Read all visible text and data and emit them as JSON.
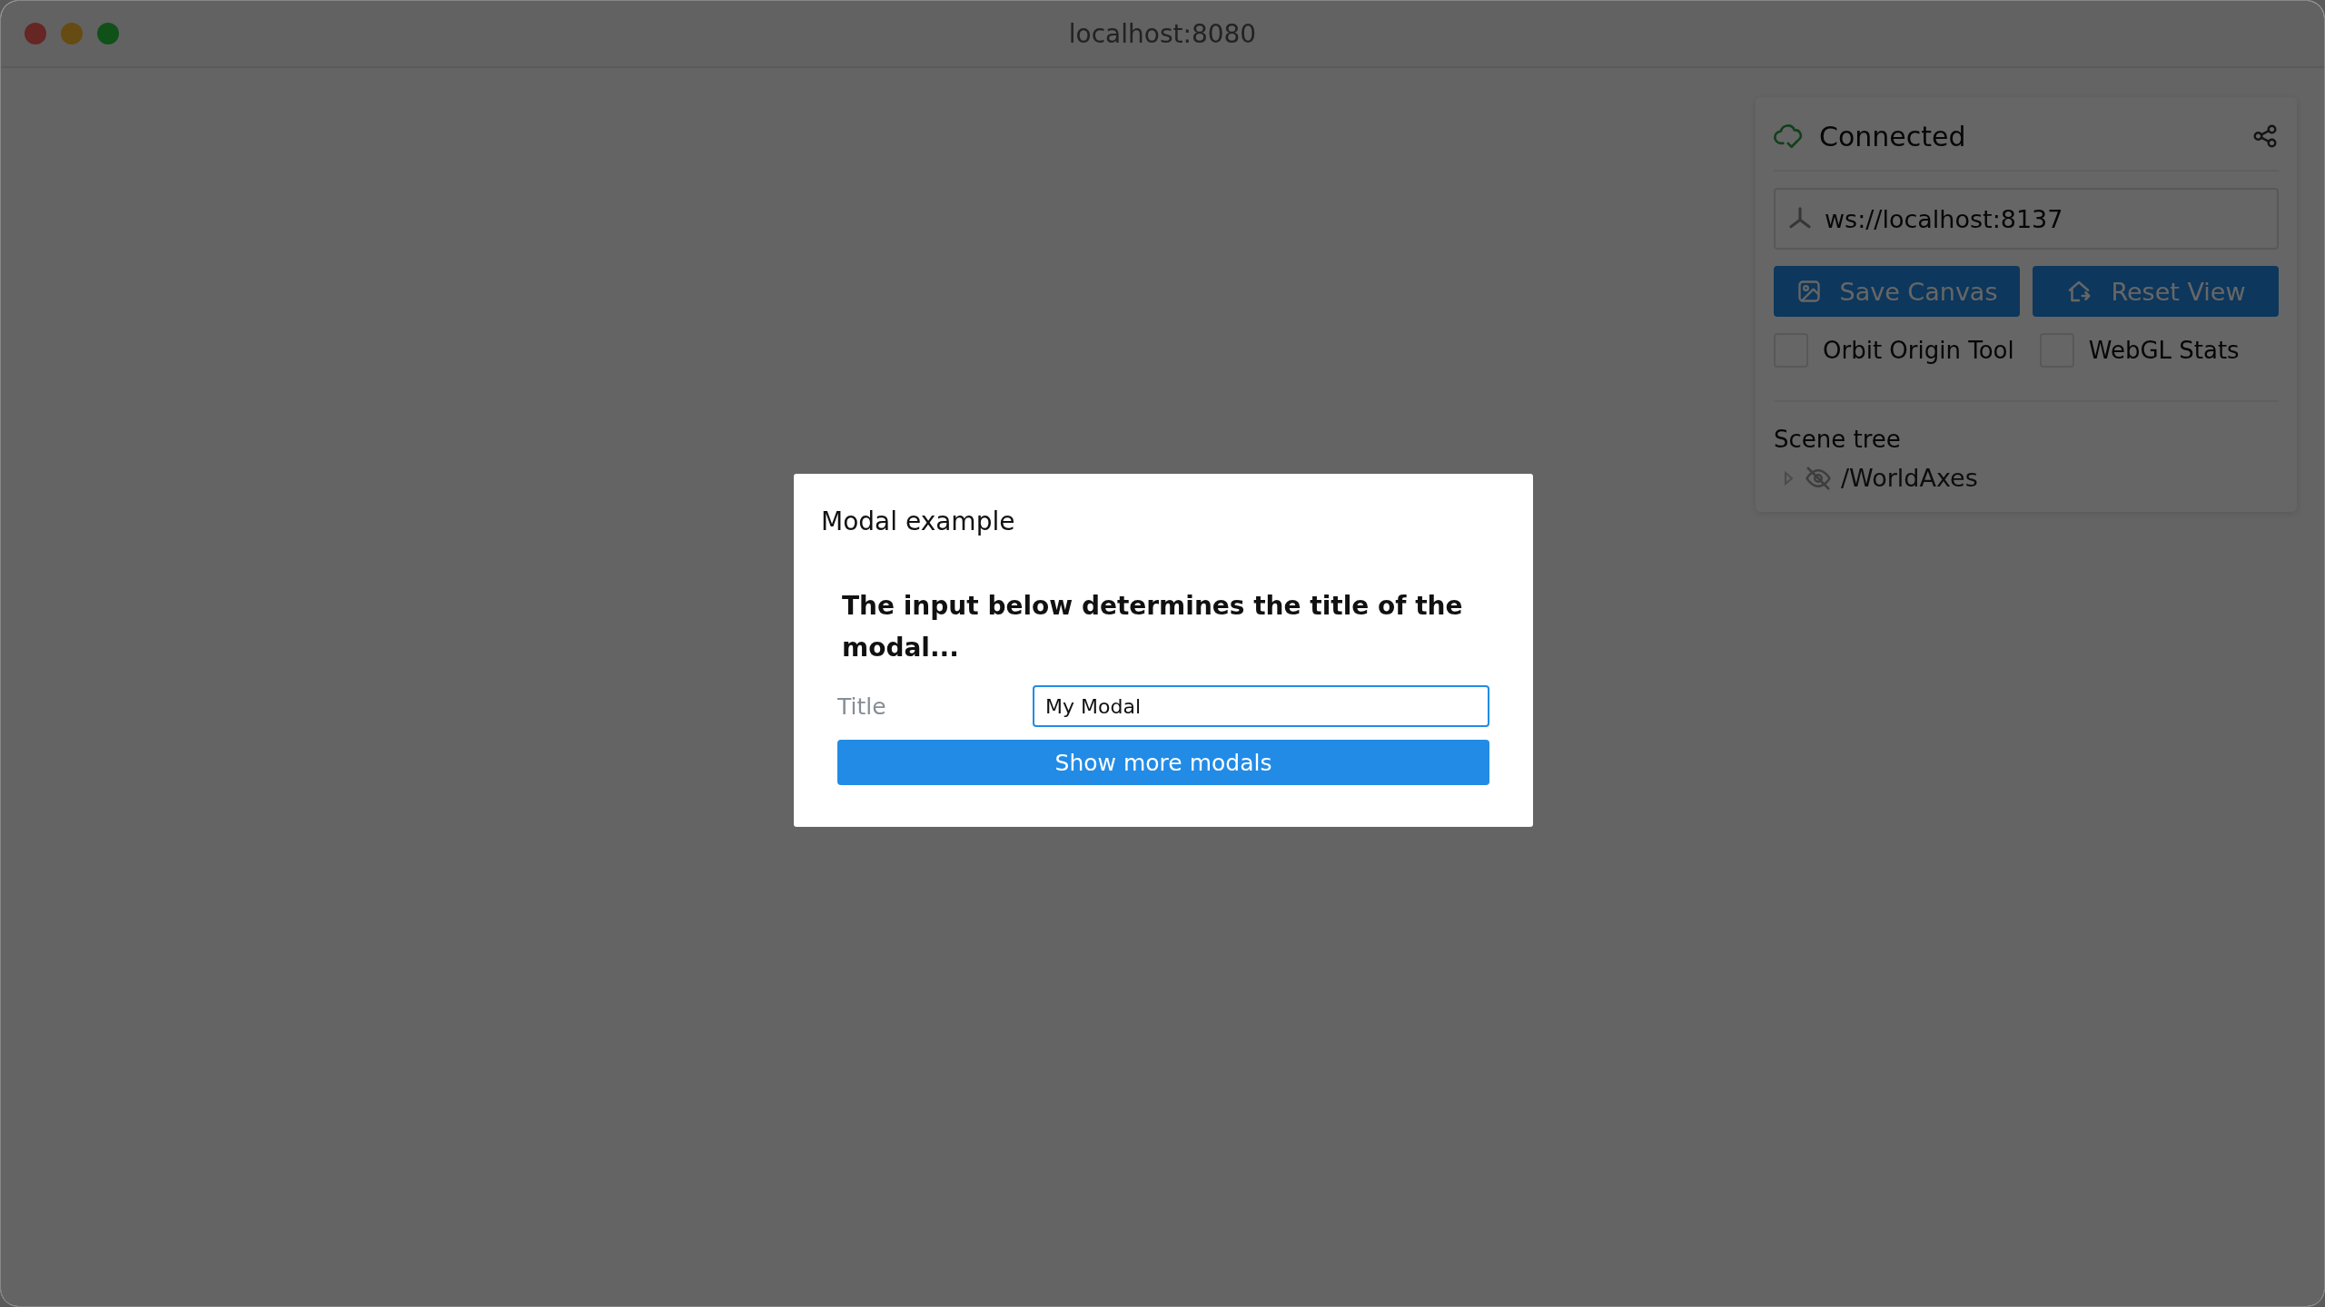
{
  "window": {
    "title": "localhost:8080"
  },
  "panel": {
    "status": "Connected",
    "server_url": "ws://localhost:8137",
    "buttons": [
      {
        "kind": "save",
        "label": "Save Canvas"
      },
      {
        "kind": "reset",
        "label": "Reset View"
      }
    ],
    "checkboxes": [
      {
        "label": "Orbit Origin Tool",
        "checked": false
      },
      {
        "label": "WebGL Stats",
        "checked": false
      }
    ],
    "scene_tree": {
      "title": "Scene tree",
      "nodes": [
        {
          "label": "/WorldAxes",
          "visible": false,
          "expanded": false
        }
      ]
    }
  },
  "modal": {
    "title": "Modal example",
    "heading": "The input below determines the title of the modal...",
    "field_label": "Title",
    "field_value": "My Modal",
    "button": "Show more modals"
  }
}
